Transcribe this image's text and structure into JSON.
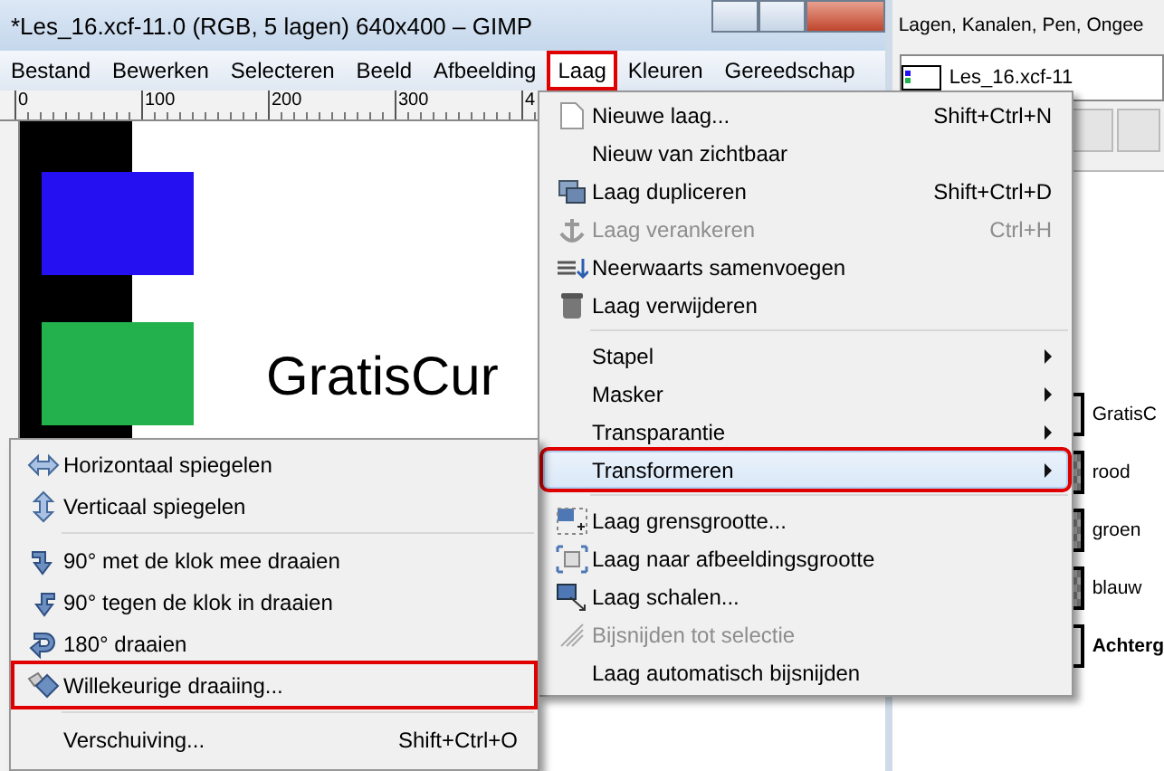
{
  "window": {
    "title": "*Les_16.xcf-11.0 (RGB, 5 lagen) 640x400 – GIMP"
  },
  "menubar": [
    {
      "label": "Bestand",
      "selected": false,
      "highlighted": false
    },
    {
      "label": "Bewerken",
      "selected": false,
      "highlighted": false
    },
    {
      "label": "Selecteren",
      "selected": false,
      "highlighted": false
    },
    {
      "label": "Beeld",
      "selected": false,
      "highlighted": false
    },
    {
      "label": "Afbeelding",
      "selected": false,
      "highlighted": false
    },
    {
      "label": "Laag",
      "selected": true,
      "highlighted": true
    },
    {
      "label": "Kleuren",
      "selected": false,
      "highlighted": false
    },
    {
      "label": "Gereedschap",
      "selected": false,
      "highlighted": false
    }
  ],
  "ruler": [
    "0",
    "100",
    "200",
    "300",
    "4"
  ],
  "canvas": {
    "text": "GratisCur"
  },
  "dock": {
    "title": "Lagen, Kanalen, Pen, Ongee",
    "image": "Les_16.xcf-11",
    "layers": [
      {
        "name": "GratisC",
        "kind": "text",
        "selected": false
      },
      {
        "name": "rood",
        "kind": "image",
        "selected": false
      },
      {
        "name": "groen",
        "kind": "image",
        "selected": false
      },
      {
        "name": "blauw",
        "kind": "image",
        "selected": false
      },
      {
        "name": "Achterg",
        "kind": "background",
        "selected": false
      }
    ]
  },
  "layer_menu": [
    {
      "kind": "item",
      "label": "Nieuwe laag...",
      "shortcut": "Shift+Ctrl+N",
      "disabled": false,
      "submenu": false,
      "selected": false,
      "highlighted": false
    },
    {
      "kind": "item",
      "label": "Nieuw van zichtbaar",
      "disabled": false,
      "submenu": false,
      "selected": false,
      "highlighted": false
    },
    {
      "kind": "item",
      "label": "Laag dupliceren",
      "shortcut": "Shift+Ctrl+D",
      "disabled": false,
      "submenu": false,
      "selected": false,
      "highlighted": false
    },
    {
      "kind": "item",
      "label": "Laag verankeren",
      "shortcut": "Ctrl+H",
      "disabled": true,
      "submenu": false,
      "selected": false,
      "highlighted": false
    },
    {
      "kind": "item",
      "label": "Neerwaarts samenvoegen",
      "disabled": false,
      "submenu": false,
      "selected": false,
      "highlighted": false
    },
    {
      "kind": "item",
      "label": "Laag verwijderen",
      "disabled": false,
      "submenu": false,
      "selected": false,
      "highlighted": false
    },
    {
      "kind": "separator"
    },
    {
      "kind": "item",
      "label": "Stapel",
      "disabled": false,
      "submenu": true,
      "selected": false,
      "highlighted": false
    },
    {
      "kind": "item",
      "label": "Masker",
      "disabled": false,
      "submenu": true,
      "selected": false,
      "highlighted": false
    },
    {
      "kind": "item",
      "label": "Transparantie",
      "disabled": false,
      "submenu": true,
      "selected": false,
      "highlighted": false
    },
    {
      "kind": "item",
      "label": "Transformeren",
      "disabled": false,
      "submenu": true,
      "selected": true,
      "highlighted": true
    },
    {
      "kind": "separator"
    },
    {
      "kind": "item",
      "label": "Laag grensgrootte...",
      "disabled": false,
      "submenu": false,
      "selected": false,
      "highlighted": false
    },
    {
      "kind": "item",
      "label": "Laag naar afbeeldingsgrootte",
      "disabled": false,
      "submenu": false,
      "selected": false,
      "highlighted": false
    },
    {
      "kind": "item",
      "label": "Laag schalen...",
      "disabled": false,
      "submenu": false,
      "selected": false,
      "highlighted": false
    },
    {
      "kind": "item",
      "label": "Bijsnijden tot selectie",
      "disabled": true,
      "submenu": false,
      "selected": false,
      "highlighted": false
    },
    {
      "kind": "item",
      "label": "Laag automatisch bijsnijden",
      "disabled": false,
      "submenu": false,
      "selected": false,
      "highlighted": false
    }
  ],
  "transform_menu": [
    {
      "kind": "item",
      "label": "Horizontaal spiegelen",
      "disabled": false,
      "selected": false,
      "highlighted": false
    },
    {
      "kind": "item",
      "label": "Verticaal spiegelen",
      "disabled": false,
      "selected": false,
      "highlighted": false
    },
    {
      "kind": "separator"
    },
    {
      "kind": "item",
      "label": "90° met de klok mee draaien",
      "disabled": false,
      "selected": false,
      "highlighted": false
    },
    {
      "kind": "item",
      "label": "90° tegen de klok in draaien",
      "disabled": false,
      "selected": false,
      "highlighted": false
    },
    {
      "kind": "item",
      "label": "180° draaien",
      "disabled": false,
      "selected": false,
      "highlighted": false
    },
    {
      "kind": "item",
      "label": "Willekeurige draaiing...",
      "disabled": false,
      "selected": false,
      "highlighted": true
    },
    {
      "kind": "separator"
    },
    {
      "kind": "item",
      "label": "Verschuiving...",
      "shortcut": "Shift+Ctrl+O",
      "disabled": false,
      "selected": false,
      "highlighted": false
    }
  ]
}
